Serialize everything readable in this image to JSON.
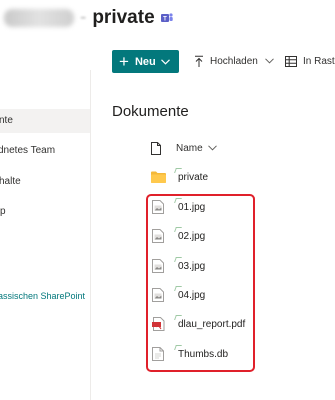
{
  "site": {
    "name": "private"
  },
  "nav": {
    "items": [
      {
        "label": "nte"
      },
      {
        "label": "dnetes Team"
      },
      {
        "label": "halte"
      },
      {
        "label": "p"
      }
    ],
    "classic_link": "assischen SharePoint"
  },
  "toolbar": {
    "new_label": "Neu",
    "upload_label": "Hochladen",
    "grid_label": "In Raste"
  },
  "library": {
    "title": "Dokumente",
    "name_column": "Name",
    "files": [
      {
        "name": "private",
        "type": "folder"
      },
      {
        "name": "01.jpg",
        "type": "image"
      },
      {
        "name": "02.jpg",
        "type": "image"
      },
      {
        "name": "03.jpg",
        "type": "image"
      },
      {
        "name": "04.jpg",
        "type": "image"
      },
      {
        "name": "dlau_report.pdf",
        "type": "pdf"
      },
      {
        "name": "Thumbs.db",
        "type": "file"
      }
    ]
  },
  "colors": {
    "accent": "#03787c",
    "folder": "#f4b93a",
    "highlight": "#e0202a",
    "teams": "#5b5fc7"
  }
}
